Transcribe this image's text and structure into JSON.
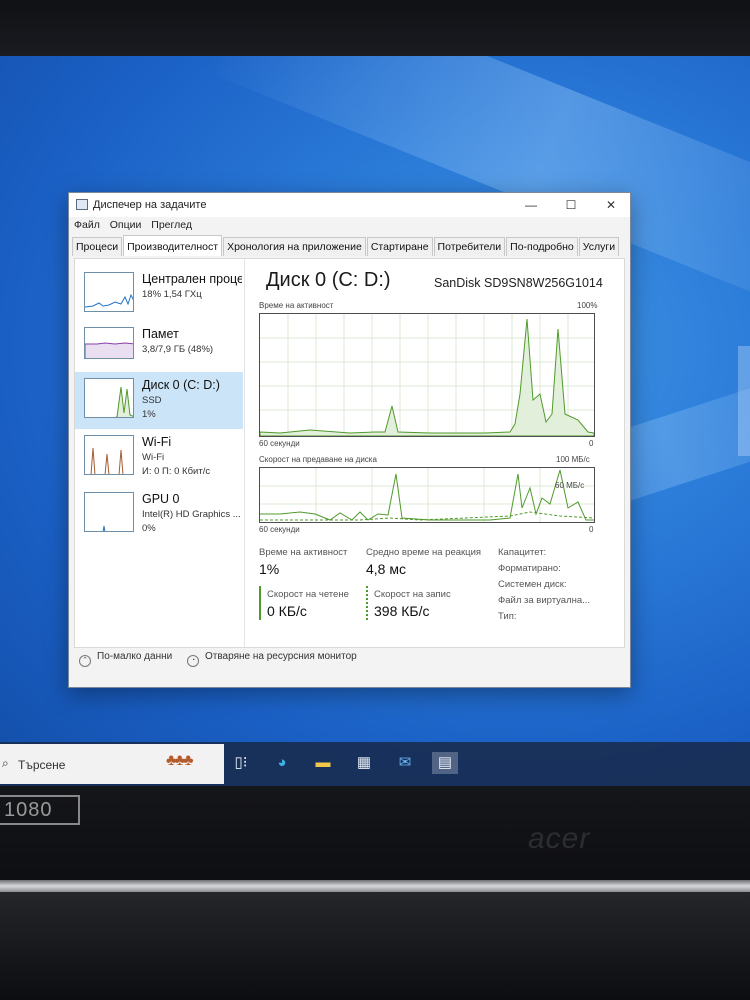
{
  "window": {
    "title": "Диспечер на задачите",
    "controls": {
      "minimize": "—",
      "maximize": "☐",
      "close": "✕"
    }
  },
  "menu": [
    "Файл",
    "Опции",
    "Преглед"
  ],
  "tabs": [
    "Процеси",
    "Производителност",
    "Хронология на приложение",
    "Стартиране",
    "Потребители",
    "По-подробно",
    "Услуги"
  ],
  "active_tab": "Производителност",
  "sidebar": {
    "items": [
      {
        "name": "Централен процесор",
        "line1": "18% 1,54 ГХц",
        "line2": "",
        "color": "#1f73c7"
      },
      {
        "name": "Памет",
        "line1": "3,8/7,9 ГБ (48%)",
        "line2": "",
        "color": "#8b3fa8"
      },
      {
        "name": "Диск 0 (C: D:)",
        "line1": "SSD",
        "line2": "1%",
        "color": "#4f9a2b",
        "selected": true
      },
      {
        "name": "Wi-Fi",
        "line1": "Wi-Fi",
        "line2": "И: 0 П: 0 Кбит/с",
        "color": "#a35d2f"
      },
      {
        "name": "GPU 0",
        "line1": "Intel(R) HD Graphics ...",
        "line2": "0%",
        "color": "#1f73c7"
      }
    ]
  },
  "main": {
    "title": "Диск 0 (C: D:)",
    "model": "SanDisk SD9SN8W256G1014",
    "graph1": {
      "label": "Време на активност",
      "max": "100%",
      "time": "60 секунди",
      "min": "0"
    },
    "graph2": {
      "label": "Скорост на предаване на диска",
      "max": "100 МБ/с",
      "inner": "60 МБ/с",
      "time": "60 секунди",
      "min": "0"
    },
    "stats": {
      "active_time_label": "Време на активност",
      "active_time": "1%",
      "avg_response_label": "Средно време на реакция",
      "avg_response": "4,8 мс",
      "read_label": "Скорост на четене",
      "read": "0 КБ/с",
      "write_label": "Скорост на запис",
      "write": "398 КБ/с"
    },
    "props": [
      "Капацитет:",
      "Форматирано:",
      "Системен диск:",
      "Файл за виртуална...",
      "Тип:"
    ]
  },
  "footer": {
    "fewer": "По-малко данни",
    "monitor": "Отваряне на ресурсния монитор"
  },
  "taskbar": {
    "search": "Търсене",
    "icons": [
      "task-view-icon",
      "edge-icon",
      "file-explorer-icon",
      "store-icon",
      "mail-icon",
      "task-manager-icon"
    ]
  },
  "bezel": {
    "badge": "1080",
    "brand": "acer"
  }
}
